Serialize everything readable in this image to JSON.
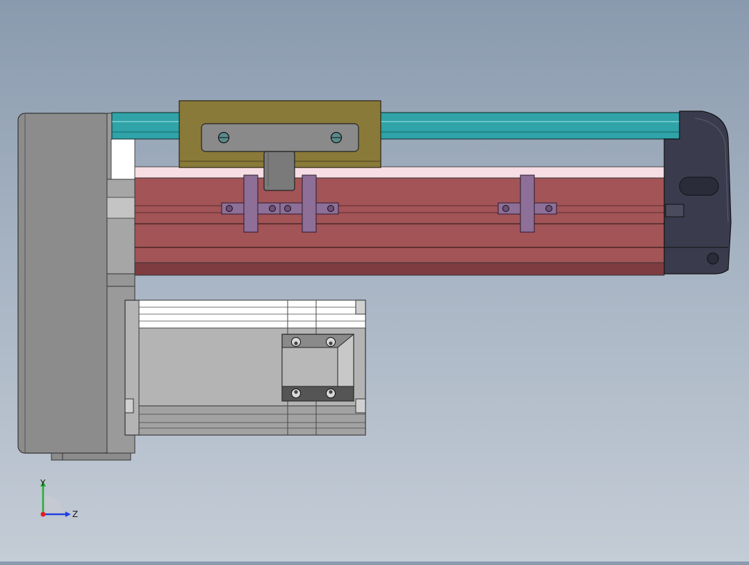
{
  "viewport": {
    "background_top": "#8a9aae",
    "background_bottom": "#c4ccd6"
  },
  "colors": {
    "carriage": "#8a7a3a",
    "rail": "#2fa3a8",
    "actuator_body": "#a25457",
    "actuator_highlight": "#f7dde4",
    "end_cap": "#3a3c4e",
    "gearbox": "#8c8c8c",
    "motor": "#b4b4b4",
    "bracket": "#8e6f97",
    "axis_x": "#e02020",
    "axis_y": "#20b030",
    "axis_z": "#2040e0"
  },
  "triad": {
    "y_label": "Y",
    "z_label": "Z"
  }
}
